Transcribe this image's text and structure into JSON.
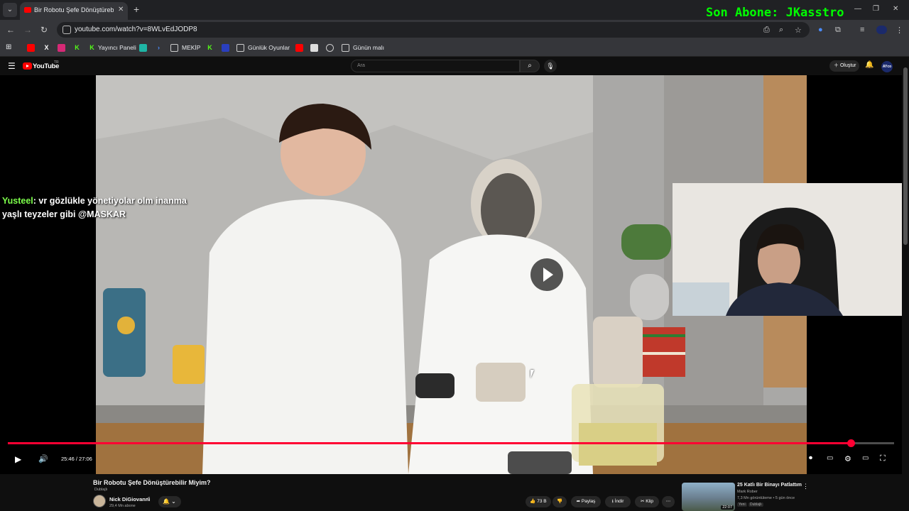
{
  "stream_overlay": {
    "banner": "Son Abone: JKasstro",
    "chat_user": "Yusteel",
    "chat_text": ": vr gözlükle yönetiyolar olm inanma yaşlı teyzeler gibi @MASKAR"
  },
  "browser": {
    "tab_title": "Bir Robotu Şefe Dönüştürebilir Miyim?",
    "url": "youtube.com/watch?v=8WLvEdJODP8",
    "bookmarks": {
      "yayinci": "Yayıncı Paneli",
      "mekip": "MEKİP",
      "gunluk": "Günlük Oyunlar",
      "gunun": "Günün malı"
    }
  },
  "youtube": {
    "logo_text": "YouTube",
    "country": "TR",
    "search_placeholder": "Ara",
    "create_label": "Oluştur",
    "avatar_text": "AYco"
  },
  "player": {
    "time": "25:46 / 27:06",
    "progress": 0.951
  },
  "video": {
    "title": "Bir Robotu Şefe Dönüştürebilir Miyim?",
    "dub_tag": "Dublajlı",
    "channel": "Nick DiGiovanni",
    "subs": "29,4 Mn abone",
    "likes": "73 B",
    "share": "Paylaş",
    "download": "İndir",
    "clip": "Klip"
  },
  "recommended": {
    "title": "25 Katlı Bir Binayı Patlattım",
    "channel": "Mark Rober",
    "meta": "7,3 Mn görüntüleme • 5 gün önce",
    "new_tag": "Yeni",
    "dub_tag": "Dublajlı",
    "duration": "22:07"
  },
  "colors": {
    "accent": "#ff0033",
    "banner": "#00ff00",
    "chat_user": "#7dff4b",
    "background": "#0f0f0f"
  }
}
